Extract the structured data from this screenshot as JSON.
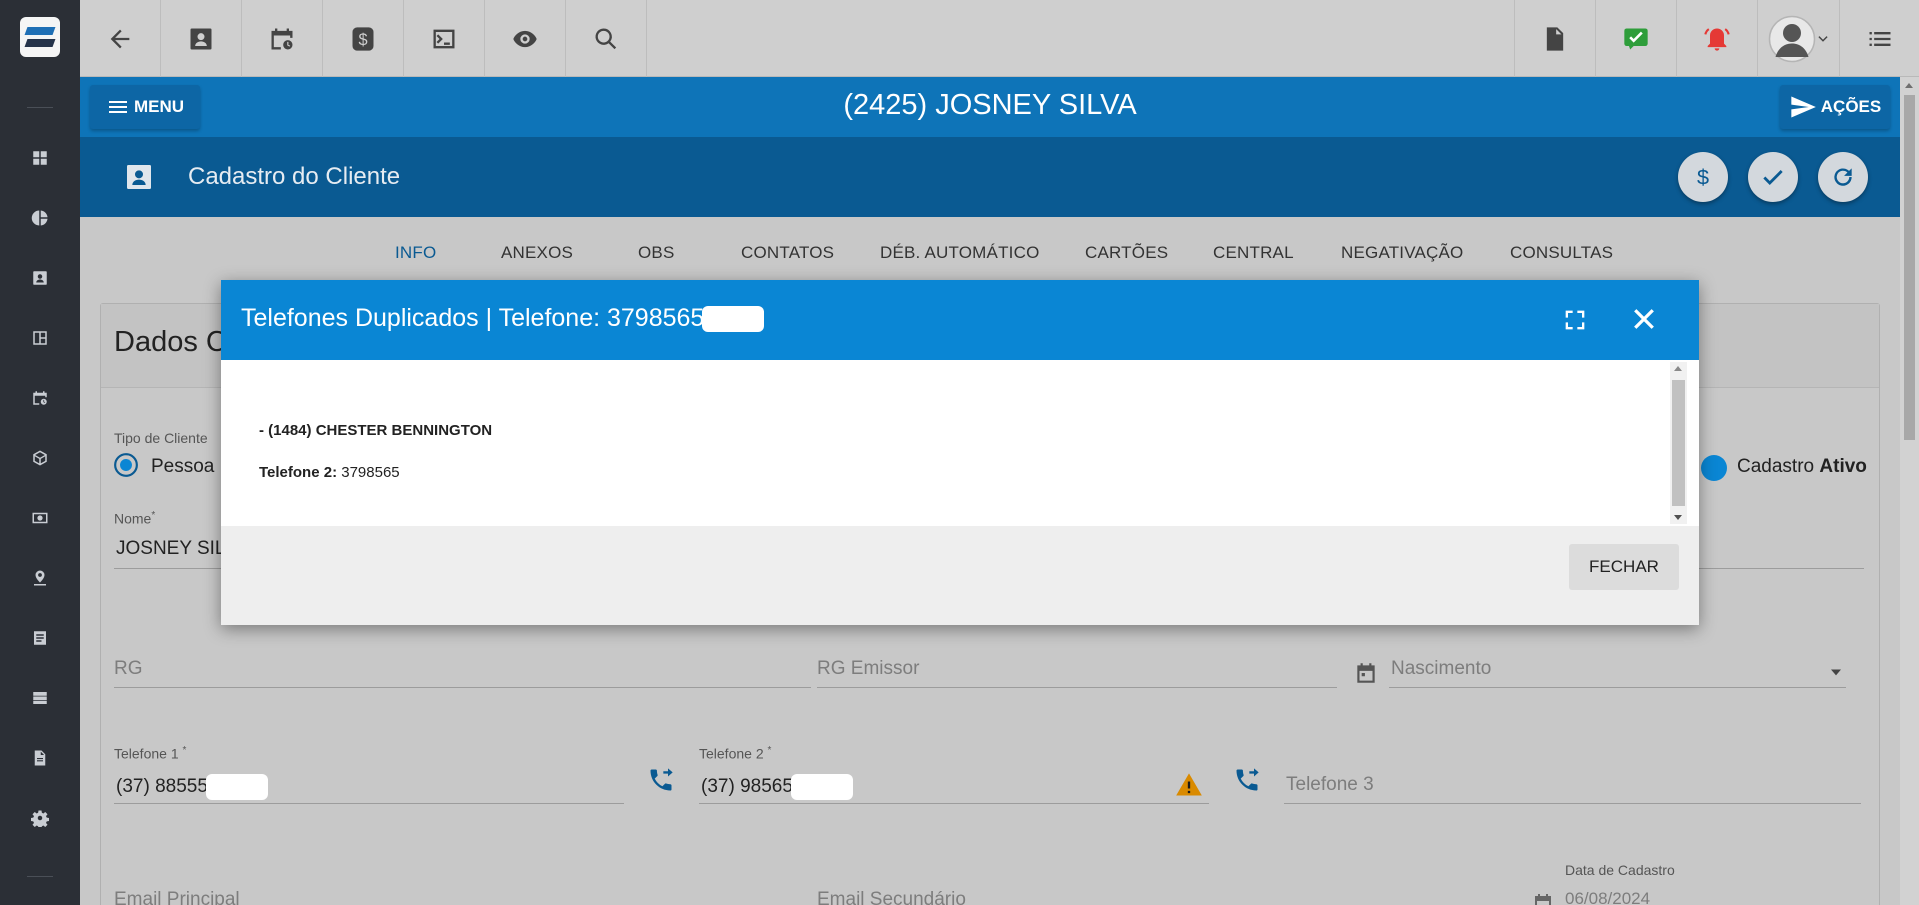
{
  "client_header": {
    "menu_label": "MENU",
    "client_name": "(2425) JOSNEY SILVA",
    "acoes_label": "AÇÕES"
  },
  "subheader": {
    "title": "Cadastro do Cliente"
  },
  "tabs": [
    {
      "label": "INFO",
      "active": true
    },
    {
      "label": "ANEXOS"
    },
    {
      "label": "OBS"
    },
    {
      "label": "CONTATOS"
    },
    {
      "label": "DÉB. AUTOMÁTICO"
    },
    {
      "label": "CARTÕES"
    },
    {
      "label": "CENTRAL"
    },
    {
      "label": "NEGATIVAÇÃO"
    },
    {
      "label": "CONSULTAS"
    }
  ],
  "form": {
    "panel_title": "Dados C",
    "tipo_cliente_label": "Tipo de Cliente",
    "tipo_cliente_value": "Pessoa",
    "cadastro_label": "Cadastro",
    "cadastro_status": "Ativo",
    "nome_label": "Nome",
    "nome_value": "JOSNEY SIL",
    "rg_placeholder": "RG",
    "rg_emissor_placeholder": "RG Emissor",
    "nascimento_placeholder": "Nascimento",
    "telefone1_label": "Telefone 1",
    "telefone1_value": "(37) 88555",
    "telefone2_label": "Telefone 2",
    "telefone2_value": "(37) 98565",
    "telefone3_placeholder": "Telefone 3",
    "email_principal_placeholder": "Email Principal",
    "email_secundario_placeholder": "Email Secundário",
    "data_cadastro_label": "Data de Cadastro",
    "data_cadastro_value": "06/08/2024",
    "required_mark": "*"
  },
  "modal": {
    "title": "Telefones Duplicados | Telefone: 3798565",
    "entry_name": "- (1484) CHESTER BENNINGTON",
    "entry_phone_label": "Telefone 2:",
    "entry_phone_value": "3798565",
    "close_button": "FECHAR"
  },
  "colors": {
    "header_blue": "#0e74b8",
    "subheader_blue": "#0a5a92",
    "modal_blue": "#0a86d4",
    "sidebar": "#2b2f36",
    "warning": "#d98a00",
    "alert_red": "#e53935",
    "check_green": "#2e9d3a"
  }
}
